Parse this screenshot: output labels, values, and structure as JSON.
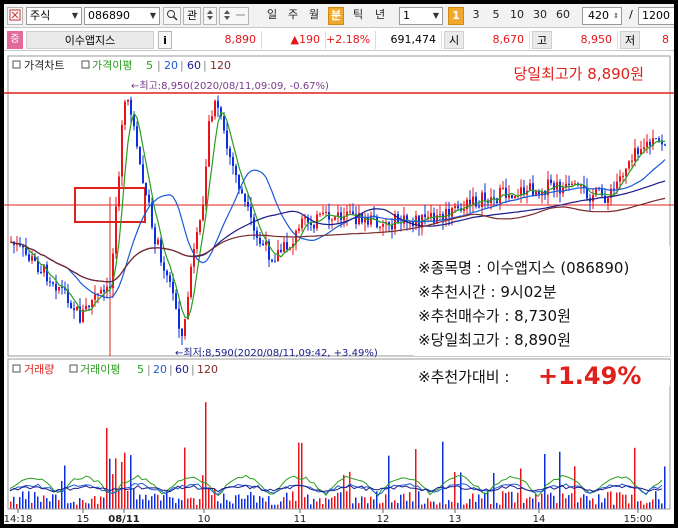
{
  "toolbar": {
    "market_type": "주식",
    "stock_code": "086890",
    "search_icon": "search-icon",
    "watch_label": "관",
    "periods": [
      "일",
      "주",
      "월",
      "분",
      "틱",
      "년"
    ],
    "active_period": "분",
    "interval_value": "1",
    "intervals": [
      "1",
      "3",
      "5",
      "10",
      "30",
      "60"
    ],
    "active_interval": "1",
    "count_value": "420",
    "slash": "/",
    "total_value": "1200"
  },
  "quote": {
    "logo_label": "증",
    "stock_name": "이수앱지스",
    "info_label": "i",
    "price": "8,890",
    "change": "▲190",
    "change_pct": "+2.18%",
    "volume": "691,474",
    "open_label": "시",
    "open": "8,670",
    "high_label": "고",
    "high": "8,950",
    "low_label": "저",
    "low_partial": "8"
  },
  "price_panel": {
    "legend_price_chart": "가격차트",
    "legend_ma_label": "가격이평",
    "legend_ma": [
      "5",
      "20",
      "60",
      "120"
    ],
    "high_annotation": "←최고:8,950(2020/08/11,09:09, -0.67%)",
    "low_annotation": "←최저:8,590(2020/08/11,09:42, +3.49%)",
    "day_high_banner": "당일최고가 8,890원",
    "info_lines": [
      "※종목명 : 이수앱지스 (086890)",
      "※추천시간 : 9시02분",
      "※추천매수가 : 8,730원",
      "※당일최고가 : 8,890원"
    ],
    "rise_label": "※추천가대비 :",
    "rise_value": "+1.49%"
  },
  "volume_panel": {
    "legend_volume": "거래량",
    "legend_ma_label": "거래이평",
    "legend_ma": [
      "5",
      "20",
      "60",
      "120"
    ]
  },
  "x_axis": {
    "ticks": [
      "14:18",
      "15",
      "08/11",
      "10",
      "11",
      "12",
      "13",
      "14",
      "15:00"
    ]
  },
  "colors": {
    "up": "#e8141a",
    "down": "#0a2ee0",
    "ma5": "#2a9d1e",
    "ma20": "#1b5bd8",
    "ma60": "#1b1b8a",
    "ma120": "#7a2a2a",
    "highlight_red": "#e0201a",
    "active_orange": "#f2a82c"
  }
}
